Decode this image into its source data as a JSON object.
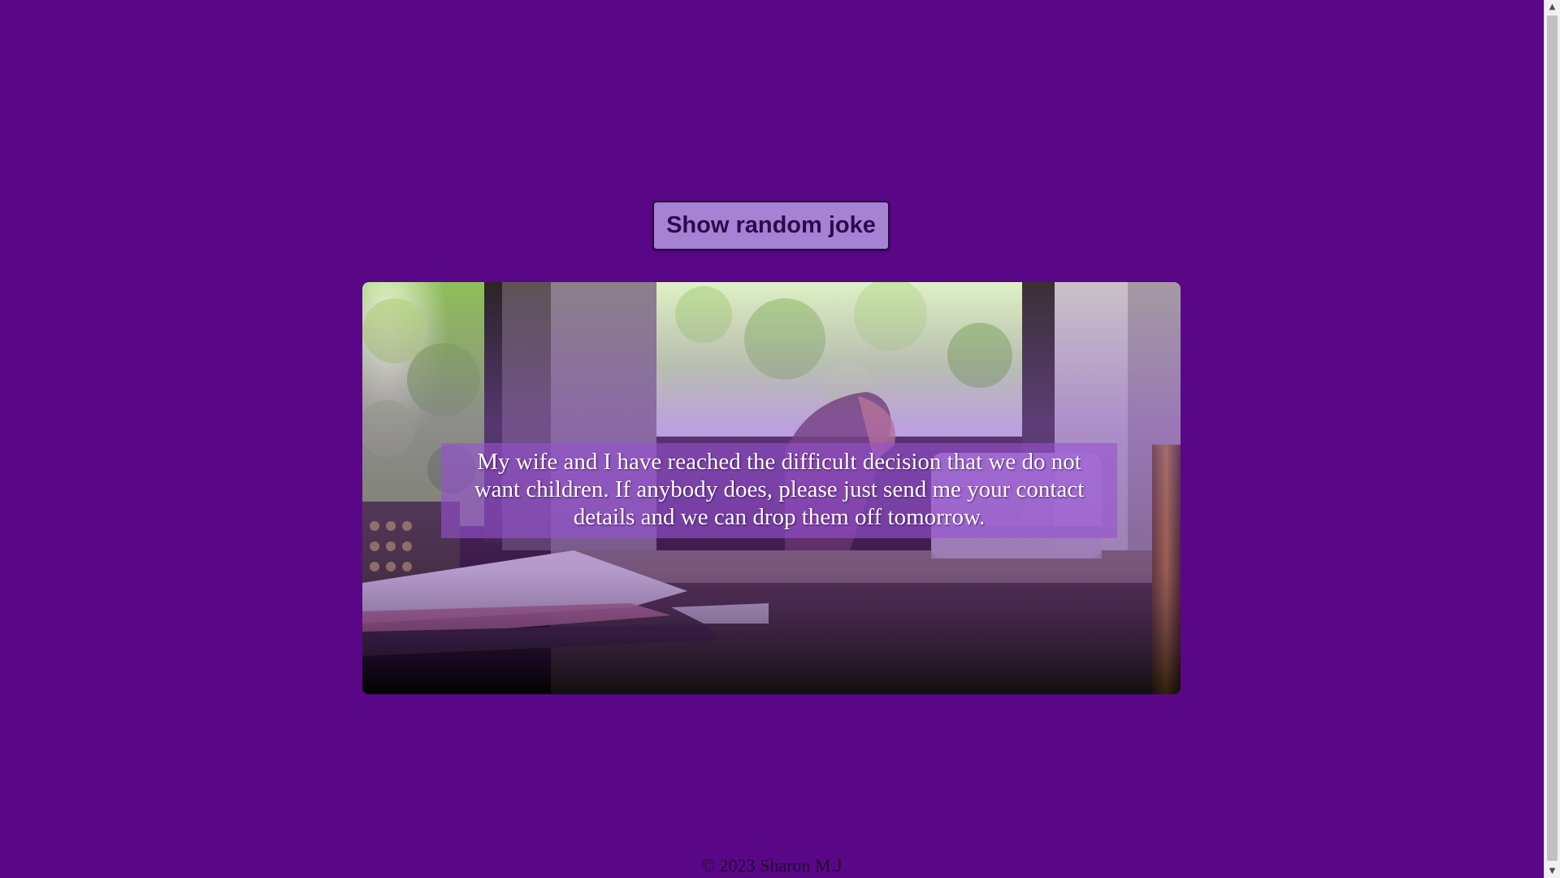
{
  "button": {
    "label": "Show random joke"
  },
  "joke": {
    "text": "My wife and I have reached the difficult decision that we do not want children. If anybody does, please just send me your contact details and we can drop them off tomorrow."
  },
  "footer": {
    "text": "© 2023 Sharon M.J"
  },
  "colors": {
    "background": "#5a0787",
    "button": "#a781d2",
    "joke_overlay": "#9650d2"
  },
  "icons": {
    "scroll_up": "triangle-up-icon",
    "scroll_down": "triangle-down-icon"
  }
}
